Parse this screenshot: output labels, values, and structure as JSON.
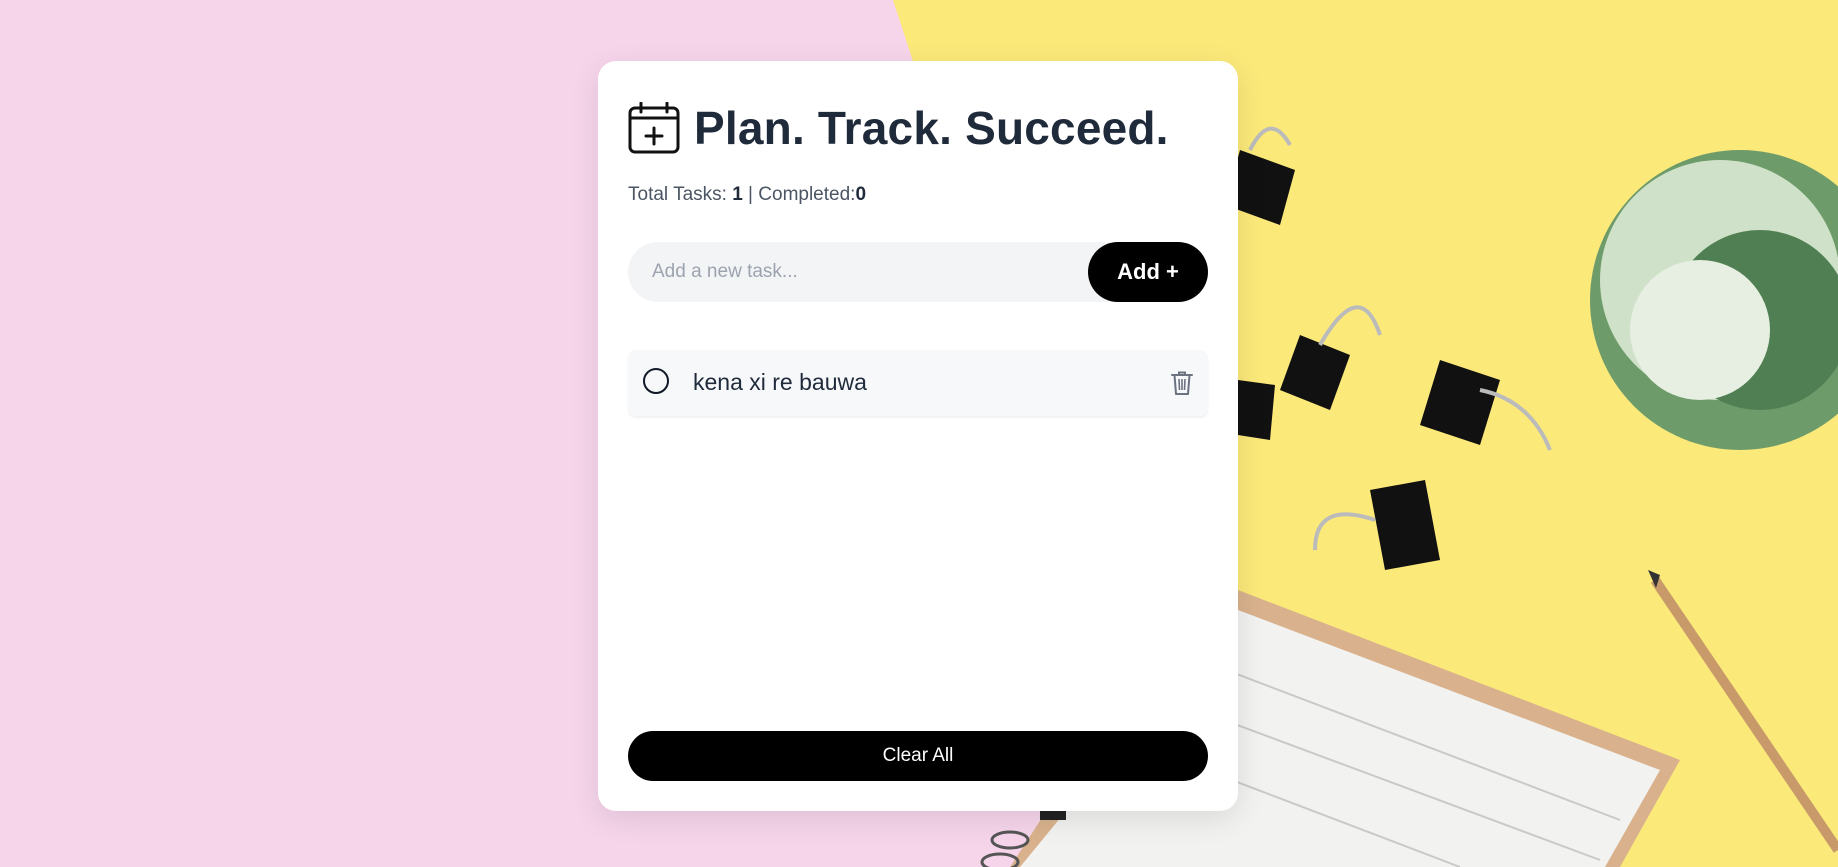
{
  "app": {
    "title": "Plan. Track. Succeed.",
    "header_icon": "calendar-plus-icon"
  },
  "stats": {
    "total_label": "Total Tasks: ",
    "total_value": "1",
    "separator": " | ",
    "completed_label": "Completed:",
    "completed_value": "0"
  },
  "add_task": {
    "placeholder": "Add a new task...",
    "value": "",
    "button_label": "Add +"
  },
  "tasks": [
    {
      "text": "kena xi re bauwa",
      "completed": false,
      "delete_icon": "trash-icon"
    }
  ],
  "footer": {
    "clear_label": "Clear All"
  },
  "colors": {
    "accent": "#000000",
    "title": "#1f2a3a",
    "bg_pink": "#f6d5ea",
    "bg_yellow": "#fbe97a"
  }
}
